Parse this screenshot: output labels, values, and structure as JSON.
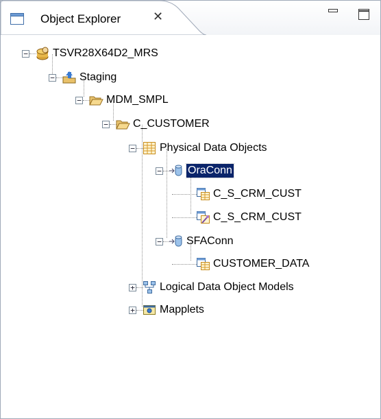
{
  "panel": {
    "tab_title": "Object Explorer",
    "close_glyph": "✕"
  },
  "tree": [
    {
      "key": "repo",
      "label": "TSVR28X64D2_MRS",
      "icon": "repository-icon"
    },
    {
      "key": "staging",
      "label": "Staging",
      "icon": "project-icon"
    },
    {
      "key": "mdm_smpl",
      "label": "MDM_SMPL",
      "icon": "folder-open-icon"
    },
    {
      "key": "c_customer",
      "label": "C_CUSTOMER",
      "icon": "folder-open-icon"
    },
    {
      "key": "pdo",
      "label": "Physical Data Objects",
      "icon": "table-grid-icon"
    },
    {
      "key": "oraconn",
      "label": "OraConn",
      "icon": "database-connection-icon",
      "selected": true
    },
    {
      "key": "c_s_crm_cust_1",
      "label": "C_S_CRM_CUST",
      "icon": "table-object-icon"
    },
    {
      "key": "c_s_crm_cust_2",
      "label": "C_S_CRM_CUST",
      "icon": "customized-table-object-icon"
    },
    {
      "key": "sfaconn",
      "label": "SFAConn",
      "icon": "database-connection-icon"
    },
    {
      "key": "customer_data",
      "label": "CUSTOMER_DATA",
      "icon": "table-object-icon"
    },
    {
      "key": "ldom",
      "label": "Logical Data Object Models",
      "icon": "logical-model-icon"
    },
    {
      "key": "mapplets",
      "label": "Mapplets",
      "icon": "mapplet-icon"
    }
  ]
}
